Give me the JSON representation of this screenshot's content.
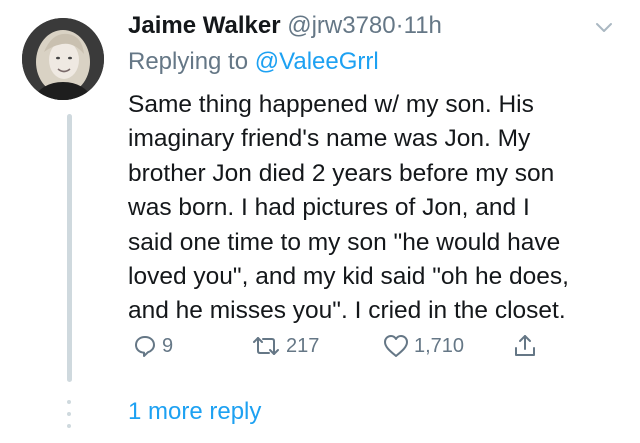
{
  "tweet": {
    "author_name": "Jaime Walker",
    "author_handle": "@jrw3780",
    "separator": "·",
    "time": "11h",
    "replying_prefix": "Replying to",
    "replying_to": "@ValeeGrrl",
    "body_lines": [
      "Same thing happened w/ my son. His",
      "imaginary friend's name was Jon. My",
      "brother Jon died 2 years before my son",
      "was born. I had pictures of Jon, and I",
      "said one time to my son \"he would have",
      "loved you\", and my kid said \"oh he does,",
      "and he misses you\". I cried in the closet."
    ],
    "reply_count": "9",
    "retweet_count": "217",
    "like_count": "1,710"
  },
  "thread": {
    "more_replies_label": "1 more reply"
  },
  "icons": {
    "reply": "reply-icon",
    "retweet": "retweet-icon",
    "like": "heart-icon",
    "share": "share-icon",
    "menu": "chevron-down-icon"
  },
  "colors": {
    "link": "#1da1f2",
    "secondary_text": "#657786",
    "primary_text": "#14171a",
    "thread_line": "#cfd9de"
  }
}
